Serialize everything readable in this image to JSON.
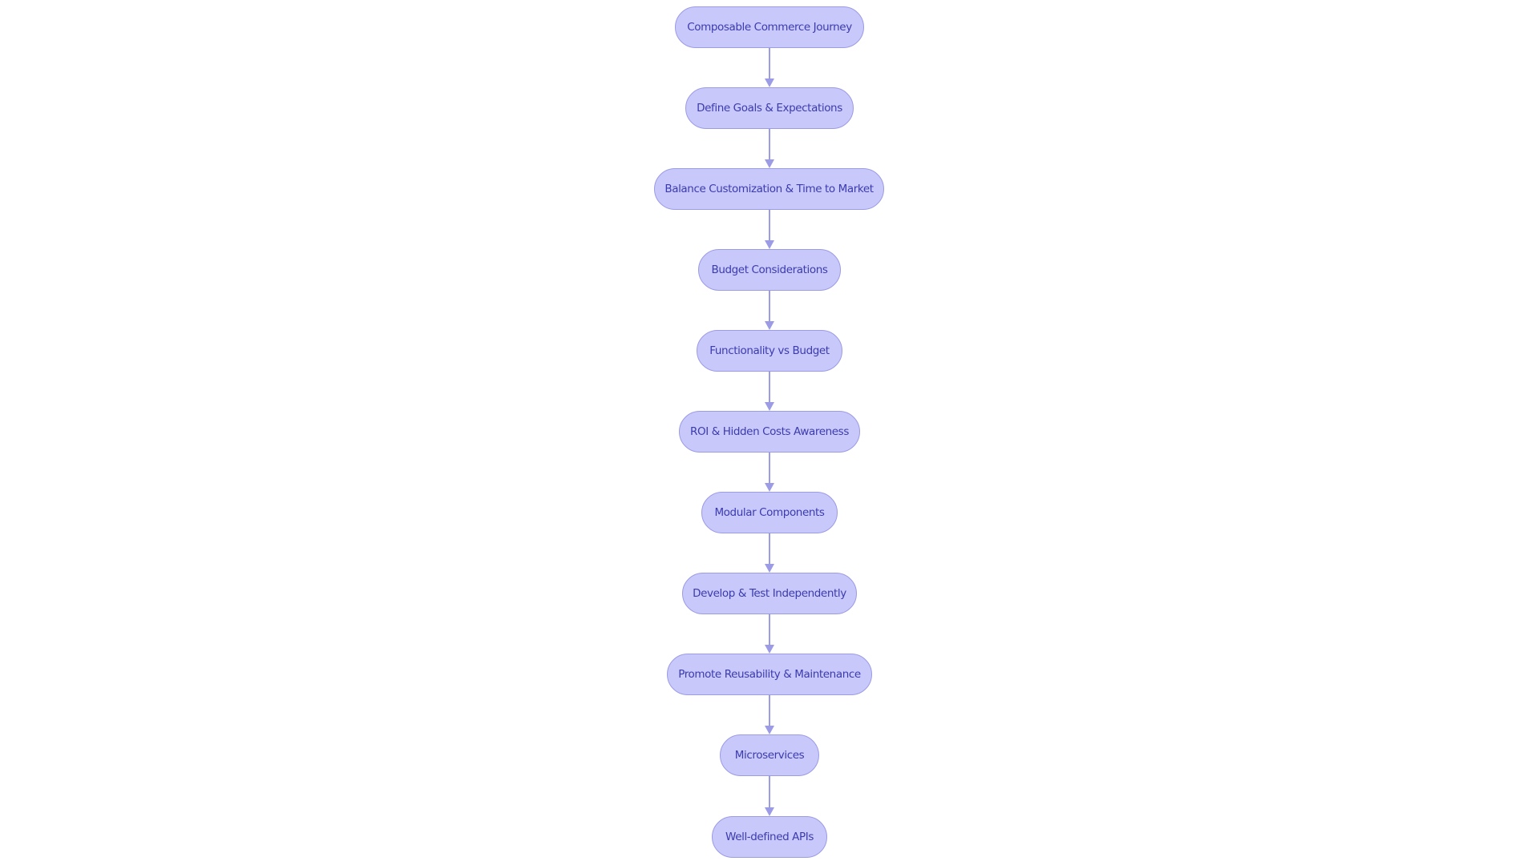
{
  "diagram": {
    "type": "flowchart",
    "direction": "top-to-bottom",
    "colors": {
      "node_fill": "#c8c8fa",
      "node_border": "#9b9be6",
      "node_text": "#3b3bb0",
      "edge": "#9b9be6"
    },
    "nodes": [
      {
        "id": "n1",
        "label": "Composable Commerce Journey"
      },
      {
        "id": "n2",
        "label": "Define Goals & Expectations"
      },
      {
        "id": "n3",
        "label": "Balance Customization & Time to Market"
      },
      {
        "id": "n4",
        "label": "Budget Considerations"
      },
      {
        "id": "n5",
        "label": "Functionality vs Budget"
      },
      {
        "id": "n6",
        "label": "ROI & Hidden Costs Awareness"
      },
      {
        "id": "n7",
        "label": "Modular Components"
      },
      {
        "id": "n8",
        "label": "Develop & Test Independently"
      },
      {
        "id": "n9",
        "label": "Promote Reusability & Maintenance"
      },
      {
        "id": "n10",
        "label": "Microservices"
      },
      {
        "id": "n11",
        "label": "Well-defined APIs"
      }
    ],
    "edges": [
      {
        "from": "n1",
        "to": "n2"
      },
      {
        "from": "n2",
        "to": "n3"
      },
      {
        "from": "n3",
        "to": "n4"
      },
      {
        "from": "n4",
        "to": "n5"
      },
      {
        "from": "n5",
        "to": "n6"
      },
      {
        "from": "n6",
        "to": "n7"
      },
      {
        "from": "n7",
        "to": "n8"
      },
      {
        "from": "n8",
        "to": "n9"
      },
      {
        "from": "n9",
        "to": "n10"
      },
      {
        "from": "n10",
        "to": "n11"
      }
    ]
  }
}
